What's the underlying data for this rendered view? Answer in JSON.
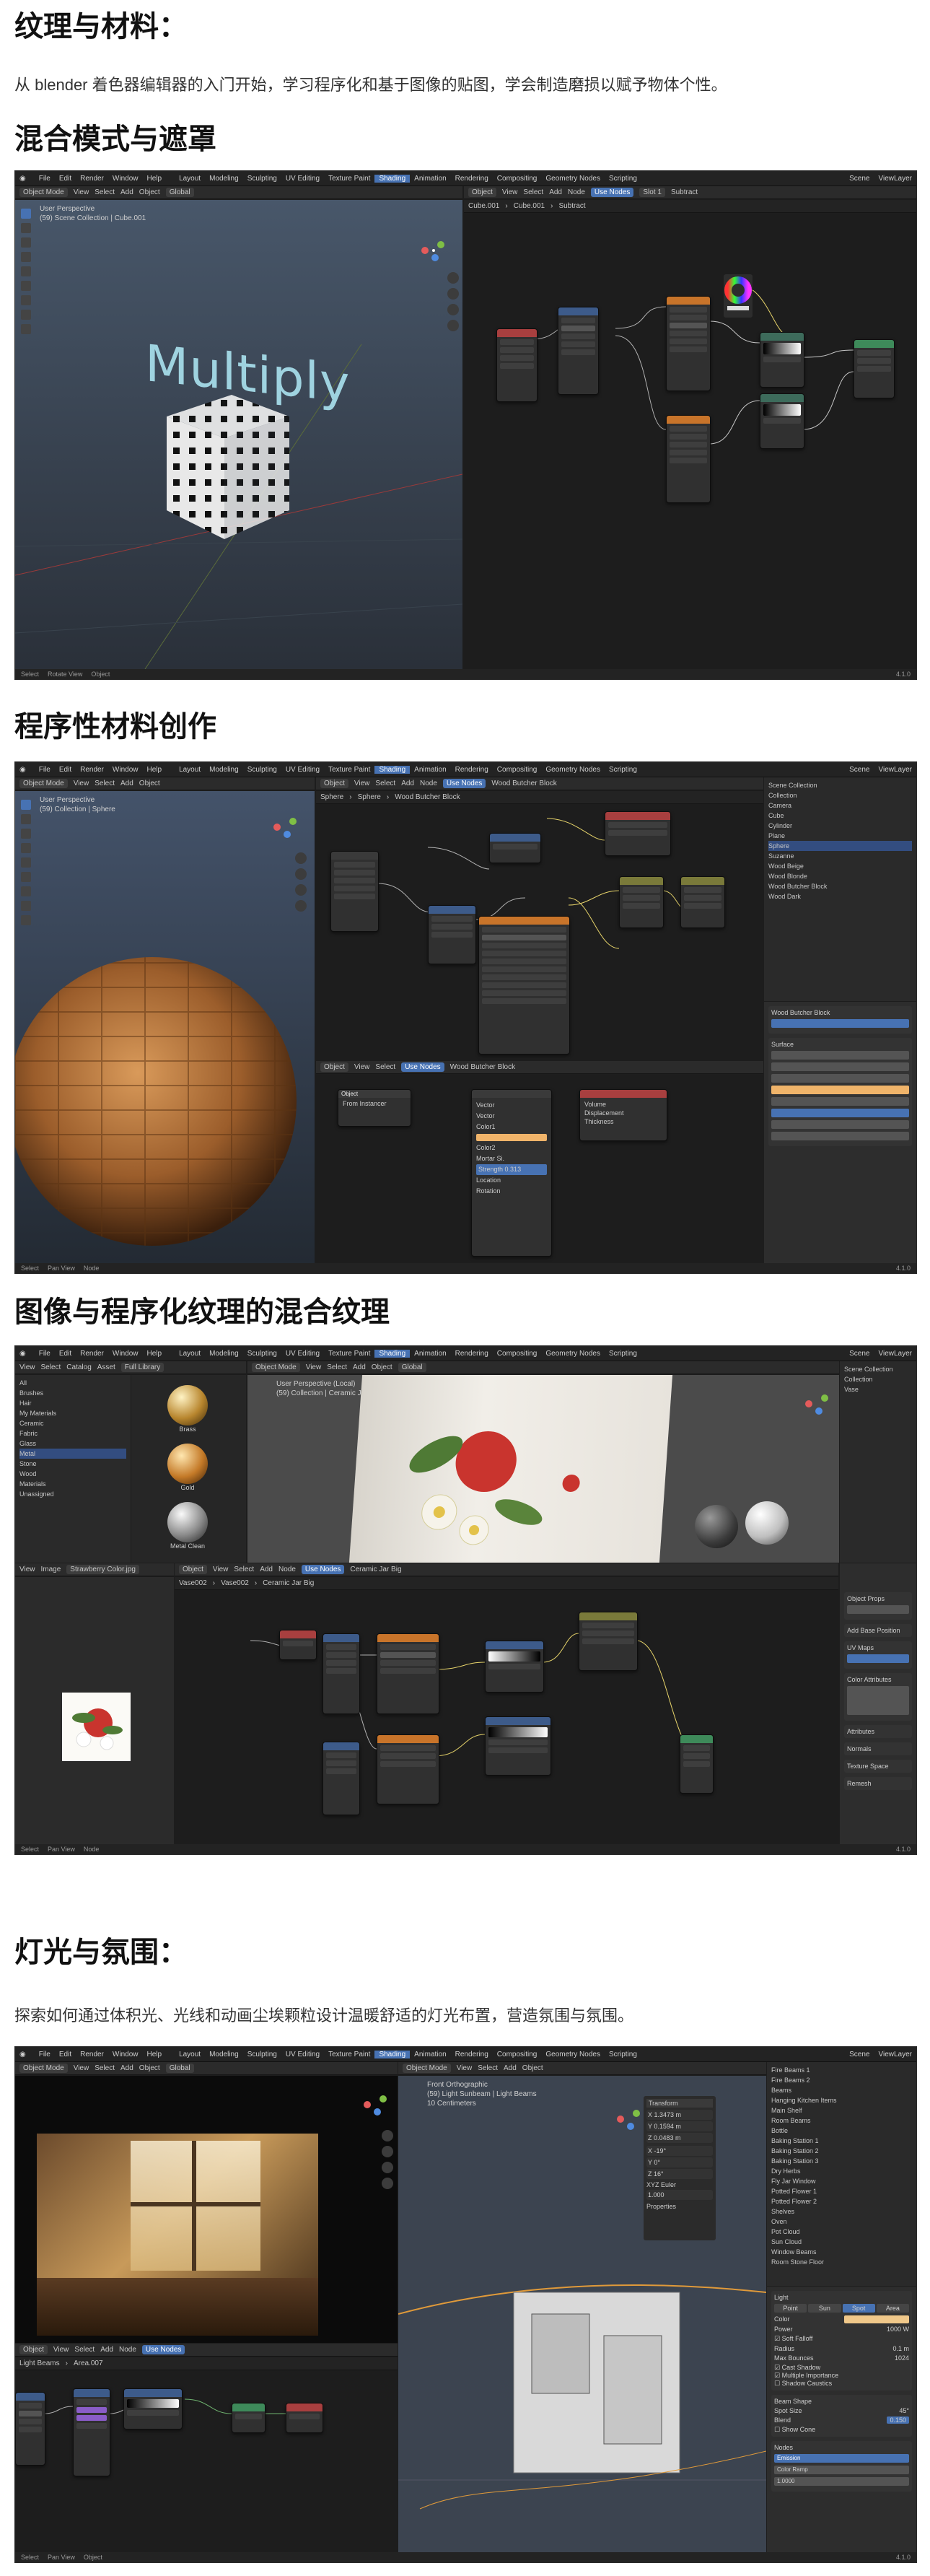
{
  "sections": {
    "textures": {
      "title": "纹理与材料：",
      "desc": "从 blender 着色器编辑器的入门开始，学习程序化和基于图像的贴图，学会制造磨损以赋予物体个性。"
    },
    "blend": {
      "title": "混合模式与遮罩"
    },
    "procedural": {
      "title": "程序性材料创作"
    },
    "mixed": {
      "title": "图像与程序化纹理的混合纹理"
    },
    "lighting": {
      "title": "灯光与氛围：",
      "desc": "探索如何通过体积光、光线和动画尘埃颗粒设计温暖舒适的灯光布置，营造氛围与氛围。"
    }
  },
  "blender": {
    "menus": [
      "File",
      "Edit",
      "Render",
      "Window",
      "Help"
    ],
    "workspaces": [
      "Layout",
      "Modeling",
      "Sculpting",
      "UV Editing",
      "Texture Paint",
      "Shading",
      "Animation",
      "Rendering",
      "Compositing",
      "Geometry Nodes",
      "Scripting"
    ],
    "active_workspace": "Shading",
    "scene": "Scene",
    "view_layer": "ViewLayer",
    "version": "4.1.0",
    "object_mode": "Object Mode",
    "viewport_menu": [
      "View",
      "Select",
      "Add",
      "Object"
    ],
    "global": "Global",
    "node_header": [
      "Object",
      "View",
      "Select",
      "Add",
      "Node"
    ],
    "use_nodes": "Use Nodes",
    "status": [
      "Select",
      "Rotate View",
      "Object"
    ],
    "status_pan": [
      "Select",
      "Pan View",
      "Node"
    ]
  },
  "shot1": {
    "overlay": [
      "User Perspective",
      "(59) Scene Collection | Cube.001"
    ],
    "text3d": "Multiply",
    "breadcrumb": [
      "Cube.001",
      "Cube.001",
      "Subtract"
    ],
    "slot": "Slot 1"
  },
  "shot2": {
    "overlay": [
      "User Perspective",
      "(59) Collection | Sphere"
    ],
    "breadcrumb": [
      "Sphere",
      "Sphere",
      "Wood Butcher Block"
    ],
    "material": "Wood Butcher Block",
    "outliner": [
      "Scene Collection",
      "Collection",
      "Camera",
      "Cube",
      "Cylinder",
      "Plane",
      "Sphere",
      "Suzanne",
      "Wood Beige",
      "Wood Blonde",
      "Wood Butcher Block",
      "Wood Dark"
    ],
    "outliner_selected": "Sphere",
    "panel_title": "Wood Butcher Block",
    "props": [
      "Surface",
      "Volume",
      "Displacement",
      "Thickness"
    ],
    "from_instancer": "From Instancer",
    "field_labels": [
      "Vector",
      "Vector",
      "Color1",
      "Color2",
      "Mortar Si.",
      "Strength",
      "Location",
      "Rotation"
    ],
    "values": [
      "0.000",
      "0.313",
      "0 m",
      "0 m",
      "0 m",
      "0°"
    ]
  },
  "shot3": {
    "asset_header": [
      "View",
      "Select",
      "Catalog",
      "Asset"
    ],
    "library": "Full Library",
    "assets": [
      "Brass",
      "Gold",
      "Metal Clean"
    ],
    "catalog": [
      "All",
      "Brushes",
      "Hair",
      "My Materials",
      "Ceramic",
      "Fabric",
      "Glass",
      "Metal",
      "Stone",
      "Wood"
    ],
    "catalog_selected": "Metal",
    "catalog_extra": [
      "Materials",
      "Unassigned"
    ],
    "overlay": [
      "User Perspective (Local)",
      "(59) Collection | Ceramic Jar"
    ],
    "image_header": [
      "View",
      "Image"
    ],
    "image_name": "Strawberry Color.jpg",
    "breadcrumb": [
      "Vase002",
      "Vase002",
      "Ceramic Jar Big"
    ],
    "material": "Ceramic Jar Big",
    "panel": [
      "Object Props",
      "Add Base Position",
      "UV Maps",
      "Color Attributes",
      "Attributes",
      "Normals",
      "Texture Space",
      "Remesh"
    ],
    "outliner": [
      "Scene Collection",
      "Collection",
      "Vase"
    ]
  },
  "shot4": {
    "overlay_right": [
      "Front Orthographic",
      "(59) Light Sunbeam | Light Beams",
      "10 Centimeters"
    ],
    "node_path": [
      "Light Beams",
      "Area.007"
    ],
    "transform": {
      "title": "Transform",
      "location": [
        "X",
        "Y",
        "Z"
      ],
      "location_vals": [
        "1.3473 m",
        "0.1594 m",
        "0.0483 m"
      ],
      "rotation": [
        "X",
        "Y",
        "Z"
      ],
      "rotation_vals": [
        "-19°",
        "0°",
        "16°"
      ],
      "mode": "XYZ Euler",
      "scale_vals": [
        "1.000",
        "1.000",
        "1.000"
      ],
      "properties": "Properties"
    },
    "outliner": [
      "Fire Beams 1",
      "Fire Beams 2",
      "Beams",
      "Hanging Kitchen Items",
      "Main Shelf",
      "Room Beams",
      "Bottle",
      "Baking Station 1",
      "Baking Station 2",
      "Baking Station 3",
      "Dry Herbs",
      "Fly Jar Window",
      "Potted Flower 1",
      "Potted Flower 2",
      "Shelves",
      "Oven",
      "Pot Cloud",
      "Sun Cloud",
      "Window Beams",
      "Room Stone Floor"
    ],
    "light_props": {
      "section": "Light",
      "types": [
        "Point",
        "Sun",
        "Spot",
        "Area"
      ],
      "active_type": "Spot",
      "labels": [
        "Color",
        "Power",
        "Soft Falloff",
        "Radius",
        "Max Bounces",
        "Cast Shadow",
        "Multiple Importance",
        "Shadow Caustics",
        "Spot Size",
        "Blend",
        "Show Cone"
      ],
      "values": [
        "1000 W",
        "0.1 m",
        "1024",
        "45°",
        "0.150"
      ],
      "beam_shape": "Beam Shape",
      "nodes_section": "Nodes",
      "surface": "Emission",
      "color": "Color Ramp",
      "strength": "1.0000"
    }
  }
}
